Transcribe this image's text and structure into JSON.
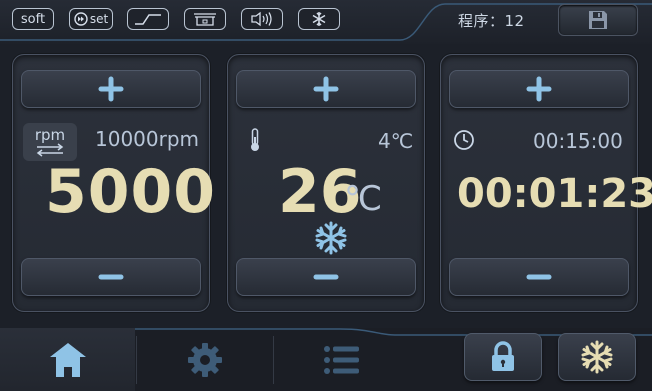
{
  "topbar": {
    "modes": [
      {
        "name": "soft-mode",
        "label": "soft"
      },
      {
        "name": "set-mode",
        "label": "set"
      },
      {
        "name": "ramp-mode",
        "label": ""
      },
      {
        "name": "lid-mode",
        "label": ""
      },
      {
        "name": "sound-mode",
        "label": ""
      },
      {
        "name": "cooling-mode",
        "label": ""
      }
    ],
    "program_label": "程序：12",
    "save_icon": "floppy-disk-icon"
  },
  "speed": {
    "unit_badge": "rpm",
    "set_value": "10000rpm",
    "current_value": "5000"
  },
  "temperature": {
    "set_value": "4℃",
    "current_value": "26",
    "unit": "℃",
    "status_icon": "snowflake-icon"
  },
  "time": {
    "set_value": "00:15:00",
    "current_value": "00:01:23"
  },
  "nav": {
    "tabs": [
      "home",
      "settings",
      "list"
    ],
    "active": "home"
  },
  "actions": [
    "lock",
    "precool"
  ],
  "colors": {
    "accent": "#8fc3e6",
    "value": "#e6ddb3",
    "text": "#c9d6e6",
    "background": "#1c2028"
  }
}
